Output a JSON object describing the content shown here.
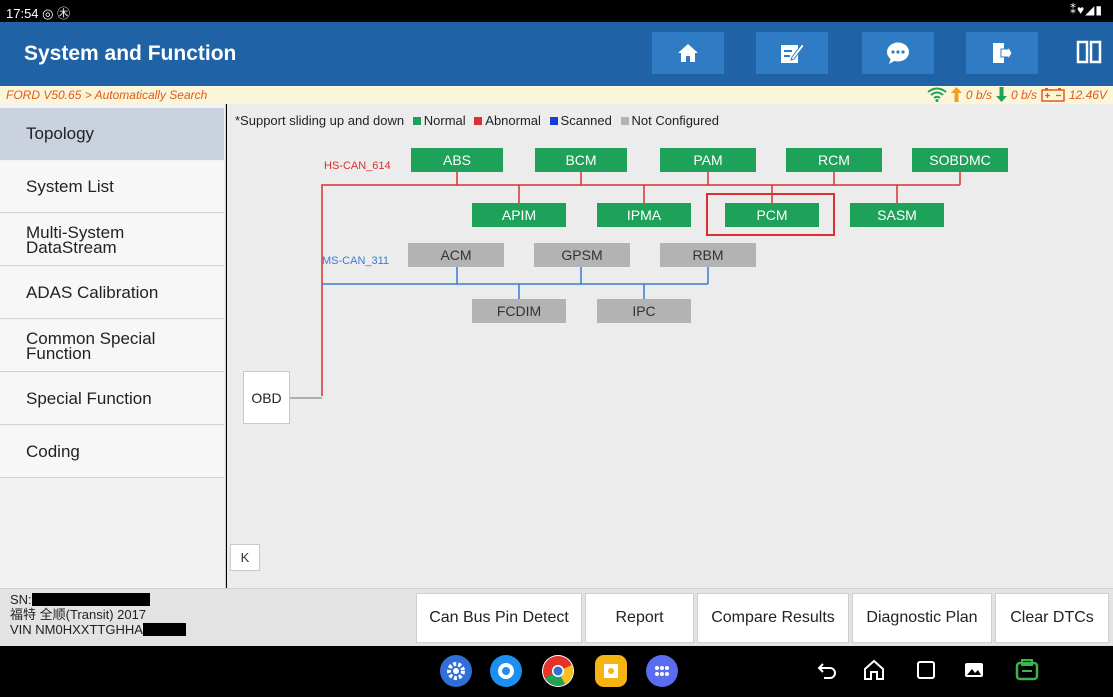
{
  "status_bar": {
    "time": "17:54 ◎ ㊍",
    "right_icons": "⁑♥◢▮"
  },
  "header": {
    "title": "System and Function",
    "buttons": [
      "home-icon",
      "edit-icon",
      "chat-icon",
      "exit-icon",
      "split-view-icon"
    ]
  },
  "info_bar": {
    "breadcrumb": "FORD V50.65 > Automatically Search",
    "upload_rate": "0 b/s",
    "download_rate": "0 b/s",
    "voltage": "12.46V"
  },
  "sidebar": {
    "items": [
      {
        "label": "Topology",
        "active": true
      },
      {
        "label": "System List"
      },
      {
        "label": "Multi-System DataStream"
      },
      {
        "label": "ADAS Calibration"
      },
      {
        "label": "Common Special Function"
      },
      {
        "label": "Special Function"
      },
      {
        "label": "Coding"
      }
    ]
  },
  "legend": {
    "hint": "*Support sliding up and down",
    "normal": "Normal",
    "abnormal": "Abnormal",
    "scanned": "Scanned",
    "not_configured": "Not Configured",
    "colors": {
      "normal": "#1ea25a",
      "abnormal": "#d93030",
      "scanned": "#1c3bd4",
      "not_configured": "#b3b3b3"
    }
  },
  "topology": {
    "hs_can": {
      "label": "HS-CAN_614",
      "color": "#d93030"
    },
    "ms_can": {
      "label": "MS-CAN_311",
      "color": "#3a7bd5"
    },
    "hs_top": [
      "ABS",
      "BCM",
      "PAM",
      "RCM",
      "SOBDMC"
    ],
    "hs_bottom": [
      "APIM",
      "IPMA",
      "PCM",
      "SASM"
    ],
    "ms_top": [
      "ACM",
      "GPSM",
      "RBM"
    ],
    "ms_bottom": [
      "FCDIM",
      "IPC"
    ],
    "highlighted": "PCM",
    "obd": "OBD",
    "collapse": "K"
  },
  "footer": {
    "sn_label": "SN:",
    "vehicle": "福特 全顺(Transit) 2017",
    "vin_label": "VIN NM0HXXTTGHHA",
    "buttons": [
      "Can Bus Pin Detect",
      "Report",
      "Compare Results",
      "Diagnostic Plan",
      "Clear DTCs"
    ]
  }
}
